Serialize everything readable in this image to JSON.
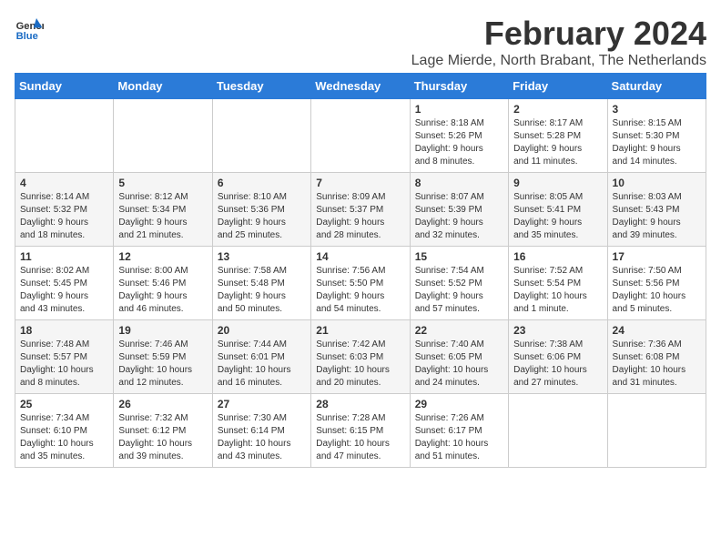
{
  "logo": {
    "text_general": "General",
    "text_blue": "Blue"
  },
  "header": {
    "month_year": "February 2024",
    "location": "Lage Mierde, North Brabant, The Netherlands"
  },
  "weekdays": [
    "Sunday",
    "Monday",
    "Tuesday",
    "Wednesday",
    "Thursday",
    "Friday",
    "Saturday"
  ],
  "weeks": [
    [
      {
        "day": "",
        "info": ""
      },
      {
        "day": "",
        "info": ""
      },
      {
        "day": "",
        "info": ""
      },
      {
        "day": "",
        "info": ""
      },
      {
        "day": "1",
        "info": "Sunrise: 8:18 AM\nSunset: 5:26 PM\nDaylight: 9 hours\nand 8 minutes."
      },
      {
        "day": "2",
        "info": "Sunrise: 8:17 AM\nSunset: 5:28 PM\nDaylight: 9 hours\nand 11 minutes."
      },
      {
        "day": "3",
        "info": "Sunrise: 8:15 AM\nSunset: 5:30 PM\nDaylight: 9 hours\nand 14 minutes."
      }
    ],
    [
      {
        "day": "4",
        "info": "Sunrise: 8:14 AM\nSunset: 5:32 PM\nDaylight: 9 hours\nand 18 minutes."
      },
      {
        "day": "5",
        "info": "Sunrise: 8:12 AM\nSunset: 5:34 PM\nDaylight: 9 hours\nand 21 minutes."
      },
      {
        "day": "6",
        "info": "Sunrise: 8:10 AM\nSunset: 5:36 PM\nDaylight: 9 hours\nand 25 minutes."
      },
      {
        "day": "7",
        "info": "Sunrise: 8:09 AM\nSunset: 5:37 PM\nDaylight: 9 hours\nand 28 minutes."
      },
      {
        "day": "8",
        "info": "Sunrise: 8:07 AM\nSunset: 5:39 PM\nDaylight: 9 hours\nand 32 minutes."
      },
      {
        "day": "9",
        "info": "Sunrise: 8:05 AM\nSunset: 5:41 PM\nDaylight: 9 hours\nand 35 minutes."
      },
      {
        "day": "10",
        "info": "Sunrise: 8:03 AM\nSunset: 5:43 PM\nDaylight: 9 hours\nand 39 minutes."
      }
    ],
    [
      {
        "day": "11",
        "info": "Sunrise: 8:02 AM\nSunset: 5:45 PM\nDaylight: 9 hours\nand 43 minutes."
      },
      {
        "day": "12",
        "info": "Sunrise: 8:00 AM\nSunset: 5:46 PM\nDaylight: 9 hours\nand 46 minutes."
      },
      {
        "day": "13",
        "info": "Sunrise: 7:58 AM\nSunset: 5:48 PM\nDaylight: 9 hours\nand 50 minutes."
      },
      {
        "day": "14",
        "info": "Sunrise: 7:56 AM\nSunset: 5:50 PM\nDaylight: 9 hours\nand 54 minutes."
      },
      {
        "day": "15",
        "info": "Sunrise: 7:54 AM\nSunset: 5:52 PM\nDaylight: 9 hours\nand 57 minutes."
      },
      {
        "day": "16",
        "info": "Sunrise: 7:52 AM\nSunset: 5:54 PM\nDaylight: 10 hours\nand 1 minute."
      },
      {
        "day": "17",
        "info": "Sunrise: 7:50 AM\nSunset: 5:56 PM\nDaylight: 10 hours\nand 5 minutes."
      }
    ],
    [
      {
        "day": "18",
        "info": "Sunrise: 7:48 AM\nSunset: 5:57 PM\nDaylight: 10 hours\nand 8 minutes."
      },
      {
        "day": "19",
        "info": "Sunrise: 7:46 AM\nSunset: 5:59 PM\nDaylight: 10 hours\nand 12 minutes."
      },
      {
        "day": "20",
        "info": "Sunrise: 7:44 AM\nSunset: 6:01 PM\nDaylight: 10 hours\nand 16 minutes."
      },
      {
        "day": "21",
        "info": "Sunrise: 7:42 AM\nSunset: 6:03 PM\nDaylight: 10 hours\nand 20 minutes."
      },
      {
        "day": "22",
        "info": "Sunrise: 7:40 AM\nSunset: 6:05 PM\nDaylight: 10 hours\nand 24 minutes."
      },
      {
        "day": "23",
        "info": "Sunrise: 7:38 AM\nSunset: 6:06 PM\nDaylight: 10 hours\nand 27 minutes."
      },
      {
        "day": "24",
        "info": "Sunrise: 7:36 AM\nSunset: 6:08 PM\nDaylight: 10 hours\nand 31 minutes."
      }
    ],
    [
      {
        "day": "25",
        "info": "Sunrise: 7:34 AM\nSunset: 6:10 PM\nDaylight: 10 hours\nand 35 minutes."
      },
      {
        "day": "26",
        "info": "Sunrise: 7:32 AM\nSunset: 6:12 PM\nDaylight: 10 hours\nand 39 minutes."
      },
      {
        "day": "27",
        "info": "Sunrise: 7:30 AM\nSunset: 6:14 PM\nDaylight: 10 hours\nand 43 minutes."
      },
      {
        "day": "28",
        "info": "Sunrise: 7:28 AM\nSunset: 6:15 PM\nDaylight: 10 hours\nand 47 minutes."
      },
      {
        "day": "29",
        "info": "Sunrise: 7:26 AM\nSunset: 6:17 PM\nDaylight: 10 hours\nand 51 minutes."
      },
      {
        "day": "",
        "info": ""
      },
      {
        "day": "",
        "info": ""
      }
    ]
  ]
}
